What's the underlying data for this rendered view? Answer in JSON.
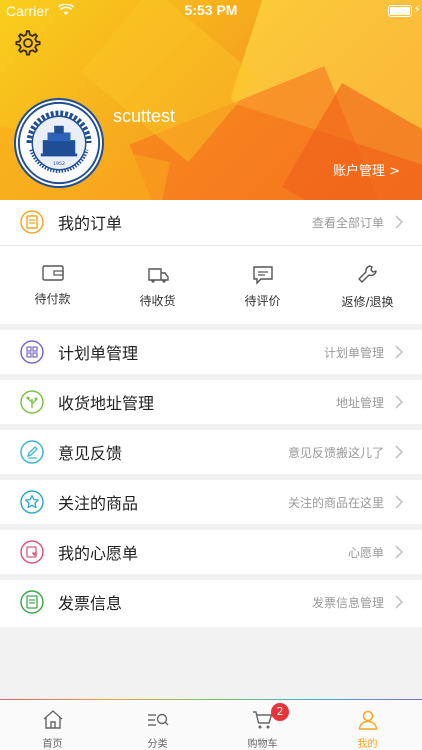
{
  "status": {
    "carrier": "Carrier",
    "time": "5:53 PM"
  },
  "profile": {
    "username": "scuttest",
    "account_label": "账户管理 >"
  },
  "orders": {
    "title": "我的订单",
    "view_all": "查看全部订单",
    "states": [
      {
        "label": "待付款",
        "icon": "wallet-icon"
      },
      {
        "label": "待收货",
        "icon": "truck-icon"
      },
      {
        "label": "待评价",
        "icon": "comment-icon"
      },
      {
        "label": "返修/退换",
        "icon": "wrench-icon"
      }
    ]
  },
  "menu": [
    {
      "label": "计划单管理",
      "hint": "计划单管理",
      "icon": "grid-icon",
      "color": "#7b68c8"
    },
    {
      "label": "收货地址管理",
      "hint": "地址管理",
      "icon": "tree-icon",
      "color": "#7cc244"
    },
    {
      "label": "意见反馈",
      "hint": "意见反馈搬这儿了",
      "icon": "pencil-icon",
      "color": "#3cb4d8"
    },
    {
      "label": "关注的商品",
      "hint": "关注的商品在这里",
      "icon": "star-icon",
      "color": "#2fa8c8"
    },
    {
      "label": "我的心愿单",
      "hint": "心愿单",
      "icon": "wishlist-icon",
      "color": "#e0567a"
    },
    {
      "label": "发票信息",
      "hint": "发票信息管理",
      "icon": "invoice-icon",
      "color": "#3ea84a"
    }
  ],
  "tabs": [
    {
      "label": "首页",
      "icon": "home-icon"
    },
    {
      "label": "分类",
      "icon": "category-search-icon"
    },
    {
      "label": "购物车",
      "icon": "cart-icon",
      "badge": "2"
    },
    {
      "label": "我的",
      "icon": "person-icon",
      "active": true
    }
  ],
  "colors": {
    "accent": "#f5a623",
    "badge": "#e8333a",
    "header_start": "#f9cf1c",
    "header_end": "#f47a22"
  }
}
